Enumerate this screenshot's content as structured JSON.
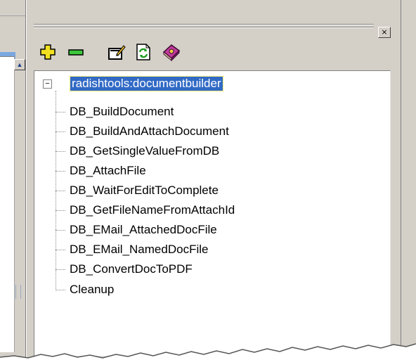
{
  "toolbar": {
    "icons": [
      "add-icon",
      "remove-icon",
      "edit-icon",
      "refresh-icon",
      "book-icon"
    ]
  },
  "panel": {
    "close_glyph": "×"
  },
  "tree": {
    "root": {
      "expander": "−",
      "label": "radishtools:documentbuilder"
    },
    "children": [
      "DB_BuildDocument",
      "DB_BuildAndAttachDocument",
      "DB_GetSingleValueFromDB",
      "DB_AttachFile",
      "DB_WaitForEditToComplete",
      "DB_GetFileNameFromAttachId",
      "DB_EMail_AttachedDocFile",
      "DB_EMail_NamedDocFile",
      "DB_ConvertDocToPDF",
      "Cleanup"
    ]
  },
  "colors": {
    "selection": "#316ac5",
    "chrome": "#d4d0c8",
    "add_icon": "#f0e020",
    "remove_icon": "#3cc83c"
  }
}
